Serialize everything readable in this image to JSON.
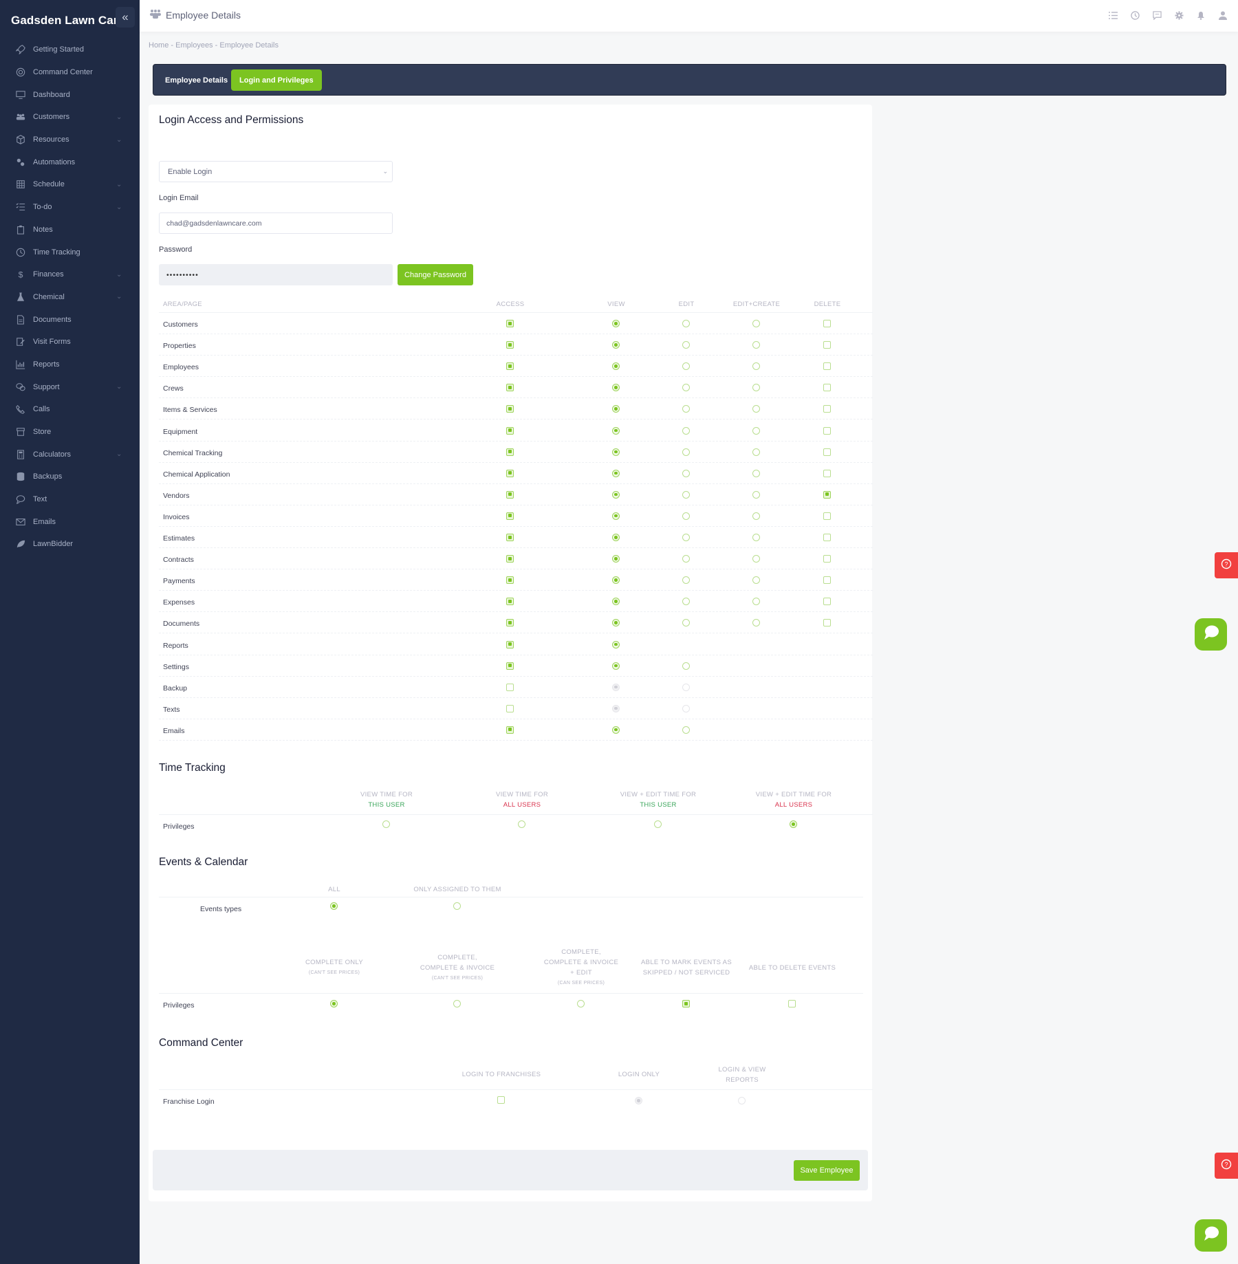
{
  "app": {
    "brand": "Gadsden Lawn Care"
  },
  "sidebar": {
    "items": [
      {
        "label": "Getting Started",
        "icon": "rocket-icon",
        "chevron": false
      },
      {
        "label": "Command Center",
        "icon": "lifebuoy-icon",
        "chevron": false
      },
      {
        "label": "Dashboard",
        "icon": "monitor-icon",
        "chevron": false
      },
      {
        "label": "Customers",
        "icon": "users-icon",
        "chevron": true
      },
      {
        "label": "Resources",
        "icon": "box-icon",
        "chevron": true
      },
      {
        "label": "Automations",
        "icon": "gears-icon",
        "chevron": false
      },
      {
        "label": "Schedule",
        "icon": "calendar-icon",
        "chevron": true
      },
      {
        "label": "To-do",
        "icon": "checklist-icon",
        "chevron": true
      },
      {
        "label": "Notes",
        "icon": "clipboard-icon",
        "chevron": false
      },
      {
        "label": "Time Tracking",
        "icon": "clock-icon",
        "chevron": false
      },
      {
        "label": "Finances",
        "icon": "dollar-icon",
        "chevron": true
      },
      {
        "label": "Chemical",
        "icon": "flask-icon",
        "chevron": true
      },
      {
        "label": "Documents",
        "icon": "document-icon",
        "chevron": false
      },
      {
        "label": "Visit Forms",
        "icon": "form-edit-icon",
        "chevron": false
      },
      {
        "label": "Reports",
        "icon": "bar-chart-icon",
        "chevron": false
      },
      {
        "label": "Support",
        "icon": "chat-bubbles-icon",
        "chevron": true
      },
      {
        "label": "Calls",
        "icon": "phone-icon",
        "chevron": false
      },
      {
        "label": "Store",
        "icon": "store-icon",
        "chevron": false
      },
      {
        "label": "Calculators",
        "icon": "calculator-icon",
        "chevron": true
      },
      {
        "label": "Backups",
        "icon": "database-icon",
        "chevron": false
      },
      {
        "label": "Text",
        "icon": "sms-icon",
        "chevron": false
      },
      {
        "label": "Emails",
        "icon": "envelope-icon",
        "chevron": false
      },
      {
        "label": "LawnBidder",
        "icon": "leaf-icon",
        "chevron": false
      }
    ]
  },
  "header": {
    "title": "Employee Details"
  },
  "breadcrumb": {
    "home": "Home",
    "sep": "-",
    "employees": "Employees",
    "current": "Employee Details"
  },
  "tabs": {
    "details": "Employee Details",
    "login": "Login and Privileges"
  },
  "login": {
    "heading": "Login Access and Permissions",
    "enable_select": "Enable Login",
    "email_label": "Login Email",
    "email_value": "chad@gadsdenlawncare.com",
    "password_label": "Password",
    "password_value": "••••••••••",
    "change_password": "Change Password"
  },
  "permissions": {
    "headers": [
      "AREA/PAGE",
      "ACCESS",
      "VIEW",
      "EDIT",
      "EDIT+CREATE",
      "DELETE"
    ],
    "rows": [
      {
        "area": "Customers",
        "access": true,
        "view": true,
        "edit": false,
        "edit_create": false,
        "delete": false
      },
      {
        "area": "Properties",
        "access": true,
        "view": true,
        "edit": false,
        "edit_create": false,
        "delete": false
      },
      {
        "area": "Employees",
        "access": true,
        "view": true,
        "edit": false,
        "edit_create": false,
        "delete": false
      },
      {
        "area": "Crews",
        "access": true,
        "view": true,
        "edit": false,
        "edit_create": false,
        "delete": false
      },
      {
        "area": "Items & Services",
        "access": true,
        "view": true,
        "edit": false,
        "edit_create": false,
        "delete": false
      },
      {
        "area": "Equipment",
        "access": true,
        "view": true,
        "edit": false,
        "edit_create": false,
        "delete": false
      },
      {
        "area": "Chemical Tracking",
        "access": true,
        "view": true,
        "edit": false,
        "edit_create": false,
        "delete": false
      },
      {
        "area": "Chemical Application",
        "access": true,
        "view": true,
        "edit": false,
        "edit_create": false,
        "delete": false
      },
      {
        "area": "Vendors",
        "access": true,
        "view": true,
        "edit": false,
        "edit_create": false,
        "delete": true
      },
      {
        "area": "Invoices",
        "access": true,
        "view": true,
        "edit": false,
        "edit_create": false,
        "delete": false
      },
      {
        "area": "Estimates",
        "access": true,
        "view": true,
        "edit": false,
        "edit_create": false,
        "delete": false
      },
      {
        "area": "Contracts",
        "access": true,
        "view": true,
        "edit": false,
        "edit_create": false,
        "delete": false
      },
      {
        "area": "Payments",
        "access": true,
        "view": true,
        "edit": false,
        "edit_create": false,
        "delete": false
      },
      {
        "area": "Expenses",
        "access": true,
        "view": true,
        "edit": false,
        "edit_create": false,
        "delete": false
      },
      {
        "area": "Documents",
        "access": true,
        "view": true,
        "edit": false,
        "edit_create": false,
        "delete": false
      },
      {
        "area": "Reports",
        "access": true,
        "view": true
      },
      {
        "area": "Settings",
        "access": true,
        "view": true,
        "edit": false
      },
      {
        "area": "Backup",
        "access": false,
        "view": true,
        "edit": false,
        "disabled": true
      },
      {
        "area": "Texts",
        "access": false,
        "view": true,
        "edit": false,
        "disabled": true
      },
      {
        "area": "Emails",
        "access": true,
        "view": true,
        "edit": false
      }
    ]
  },
  "time_tracking": {
    "heading": "Time Tracking",
    "columns": [
      {
        "top": "VIEW TIME FOR",
        "bottom": "THIS USER",
        "tone": "green"
      },
      {
        "top": "VIEW TIME FOR",
        "bottom": "ALL USERS",
        "tone": "red"
      },
      {
        "top": "VIEW + EDIT TIME FOR",
        "bottom": "THIS USER",
        "tone": "green"
      },
      {
        "top": "VIEW + EDIT TIME FOR",
        "bottom": "ALL USERS",
        "tone": "red"
      }
    ],
    "row_label": "Privileges",
    "selected": 3
  },
  "events": {
    "heading": "Events & Calendar",
    "type_headers": [
      "ALL",
      "ONLY ASSIGNED TO THEM"
    ],
    "type_label": "Events types",
    "type_selected": 0,
    "priv_headers": [
      {
        "lines": [
          "COMPLETE ONLY"
        ],
        "note": "(CAN'T SEE PRICES)"
      },
      {
        "lines": [
          "COMPLETE,",
          "COMPLETE & INVOICE"
        ],
        "note": "(CAN'T SEE PRICES)"
      },
      {
        "lines": [
          "COMPLETE,",
          "COMPLETE & INVOICE",
          "+ EDIT"
        ],
        "note": "(CAN SEE PRICES)"
      },
      {
        "lines": [
          "ABLE TO MARK EVENTS AS",
          "SKIPPED / NOT SERVICED"
        ],
        "note": ""
      },
      {
        "lines": [
          "ABLE TO DELETE EVENTS"
        ],
        "note": ""
      }
    ],
    "priv_label": "Privileges",
    "priv_selected": 0,
    "mark_skipped": true,
    "delete_events": false
  },
  "command_center": {
    "heading": "Command Center",
    "headers": [
      "LOGIN TO FRANCHISES",
      "LOGIN ONLY",
      "LOGIN & VIEW REPORTS"
    ],
    "row_label": "Franchise Login",
    "login_to_franchises": false,
    "selected": "LOGIN ONLY"
  },
  "footer": {
    "save": "Save Employee"
  }
}
